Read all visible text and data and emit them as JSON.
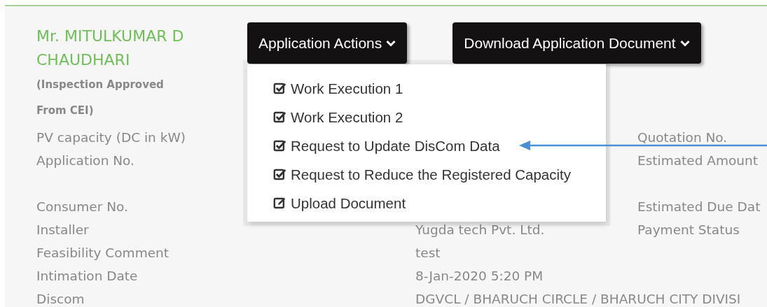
{
  "applicant": {
    "name": "Mr. MITULKUMAR D CHAUDHARI",
    "status": "(Inspection Approved From CEI)"
  },
  "buttons": [
    {
      "label": "Application Actions",
      "expanded": true
    },
    {
      "label": "Download Application Document",
      "expanded": false
    }
  ],
  "menu": {
    "items": [
      {
        "kind": "check",
        "label": "Work Execution 1"
      },
      {
        "kind": "check",
        "label": "Work Execution 2"
      },
      {
        "kind": "check",
        "label": "Request to Update DisCom Data",
        "pointed": true
      },
      {
        "kind": "check",
        "label": "Request to Reduce the Registered Capacity"
      },
      {
        "kind": "edit",
        "label": "Upload Document"
      }
    ]
  },
  "sections": [
    {
      "rows": [
        {
          "label": "PV capacity (DC in kW)",
          "right": "Quotation No."
        },
        {
          "label": "Application No.",
          "right": "Estimated Amount"
        }
      ]
    },
    {
      "rows": [
        {
          "label": "Consumer No.",
          "right": "Estimated Due Dat"
        },
        {
          "label": "Installer",
          "value": "Yugda tech Pvt. Ltd.",
          "right": "Payment Status"
        },
        {
          "label": "Feasibility Comment",
          "value": "test"
        },
        {
          "label": "Intimation Date",
          "value": "8-Jan-2020 5:20 PM"
        },
        {
          "label": "Discom",
          "value": "DGVCL / BHARUCH CIRCLE / BHARUCH CITY DIVISI"
        }
      ]
    }
  ]
}
